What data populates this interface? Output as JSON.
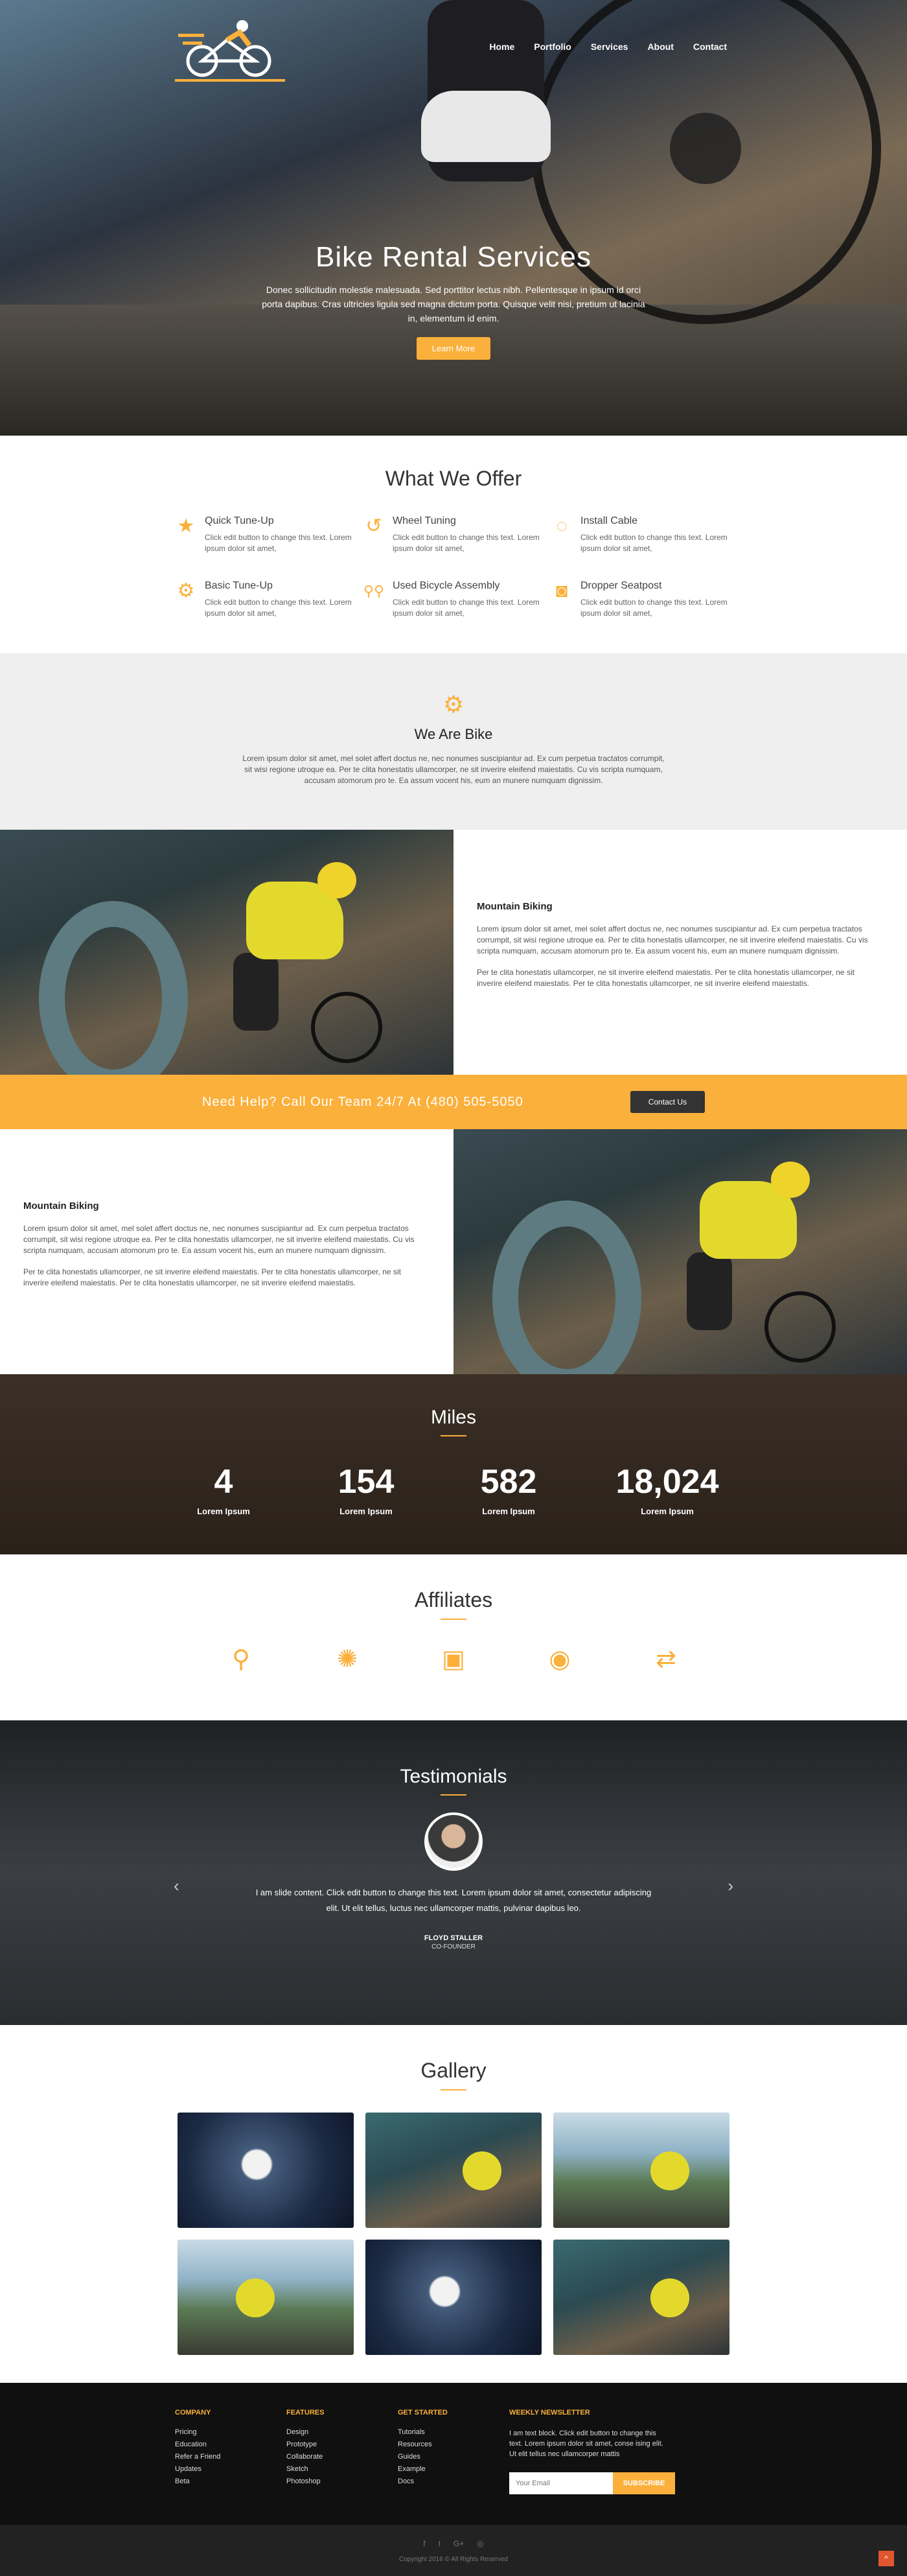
{
  "nav": {
    "items": [
      "Home",
      "Portfolio",
      "Services",
      "About",
      "Contact"
    ]
  },
  "hero": {
    "title": "Bike Rental Services",
    "desc": "Donec sollicitudin molestie malesuada. Sed porttitor lectus nibh. Pellentesque in ipsum id orci porta dapibus. Cras ultricies ligula sed magna dictum porta. Quisque velit nisi, pretium ut lacinia in, elementum id enim.",
    "button": "Learn More"
  },
  "offer": {
    "title": "What We Offer",
    "items": [
      {
        "title": "Quick Tune-Up",
        "text": "Click edit button to change this text. Lorem ipsum dolor sit amet,",
        "icon": "star-icon"
      },
      {
        "title": "Wheel Tuning",
        "text": "Click edit button to change this text. Lorem ipsum dolor sit amet,",
        "icon": "undo-icon"
      },
      {
        "title": "Install Cable",
        "text": "Click edit button to change this text. Lorem ipsum dolor sit amet,",
        "icon": "circle-notch-icon"
      },
      {
        "title": "Basic Tune-Up",
        "text": "Click edit button to change this text. Lorem ipsum dolor sit amet,",
        "icon": "gear-icon"
      },
      {
        "title": "Used Bicycle Assembly",
        "text": "Click edit button to change this text. Lorem ipsum dolor sit amet,",
        "icon": "bicycle-icon"
      },
      {
        "title": "Dropper Seatpost",
        "text": "Click edit button to change this text. Lorem ipsum dolor sit amet,",
        "icon": "stop-circle-icon"
      }
    ]
  },
  "webike": {
    "title": "We Are Bike",
    "text": "Lorem ipsum dolor sit amet, mel solet affert doctus ne, nec nonumes suscipiantur ad. Ex cum perpetua tractatos corrumpit, sit wisi regione utroque ea. Per te clita honestatis ullamcorper, ne sit inverire eleifend maiestatis. Cu vis scripta numquam, accusam atomorum pro te. Ea assum vocent his, eum an munere numquam dignissim."
  },
  "split1": {
    "title": "Mountain Biking",
    "p1": "Lorem ipsum dolor sit amet, mel solet affert doctus ne, nec nonumes suscipiantur ad. Ex cum perpetua tractatos corrumpit, sit wisi regione utroque ea. Per te clita honestatis ullamcorper, ne sit inverire eleifend maiestatis. Cu vis scripta numquam, accusam atomorum pro te. Ea assum vocent his, eum an munere numquam dignissim.",
    "p2": "Per te clita honestatis ullamcorper, ne sit inverire eleifend maiestatis. Per te clita honestatis ullamcorper, ne sit inverire eleifend maiestatis. Per te clita honestatis ullamcorper, ne sit inverire eleifend maiestatis."
  },
  "help": {
    "text": "Need Help? Call Our Team 24/7 At (480) 505-5050",
    "button": "Contact Us"
  },
  "split2": {
    "title": "Mountain Biking",
    "p1": "Lorem ipsum dolor sit amet, mel solet affert doctus ne, nec nonumes suscipiantur ad. Ex cum perpetua tractatos corrumpit, sit wisi regione utroque ea. Per te clita honestatis ullamcorper, ne sit inverire eleifend maiestatis. Cu vis scripta numquam, accusam atomorum pro te. Ea assum vocent his, eum an munere numquam dignissim.",
    "p2": "Per te clita honestatis ullamcorper, ne sit inverire eleifend maiestatis. Per te clita honestatis ullamcorper, ne sit inverire eleifend maiestatis. Per te clita honestatis ullamcorper, ne sit inverire eleifend maiestatis."
  },
  "miles": {
    "title": "Miles",
    "stats": [
      {
        "value": "4",
        "label": "Lorem Ipsum"
      },
      {
        "value": "154",
        "label": "Lorem Ipsum"
      },
      {
        "value": "582",
        "label": "Lorem Ipsum"
      },
      {
        "value": "18,024",
        "label": "Lorem Ipsum"
      }
    ]
  },
  "affiliates": {
    "title": "Affiliates",
    "icons": [
      "bicycle-icon",
      "sun-icon",
      "beer-icon",
      "cyclist-icon",
      "signpost-icon"
    ]
  },
  "testimonials": {
    "title": "Testimonials",
    "text": "I am slide content. Click edit button to change this text. Lorem ipsum dolor sit amet, consectetur adipiscing elit. Ut elit tellus, luctus nec ullamcorper mattis, pulvinar dapibus leo.",
    "name": "FLOYD STALLER",
    "role": "CO-FOUNDER"
  },
  "gallery": {
    "title": "Gallery"
  },
  "footer": {
    "columns": [
      {
        "head": "COMPANY",
        "links": [
          "Pricing",
          "Education",
          "Refer a Friend",
          "Updates",
          "Beta"
        ]
      },
      {
        "head": "FEATURES",
        "links": [
          "Design",
          "Prototype",
          "Collaborate",
          "Sketch",
          "Photoshop"
        ]
      },
      {
        "head": "GET STARTED",
        "links": [
          "Tutorials",
          "Resources",
          "Guides",
          "Example",
          "Docs"
        ]
      }
    ],
    "newsletter": {
      "head": "WEEKLY NEWSLETTER",
      "text": "I am text block. Click edit button to change this text. Lorem ipsum dolor sit amet, conse ising elit. Ut elit tellus nec ullamcorper mattis",
      "placeholder": "Your Email",
      "button": "SUBSCRIBE"
    },
    "social": [
      "f",
      "t",
      "G+",
      "◎"
    ],
    "copyright": "Copyright 2016 © All Rights Reserved"
  },
  "colors": {
    "accent": "#fbb03b",
    "footer": "#101010"
  }
}
